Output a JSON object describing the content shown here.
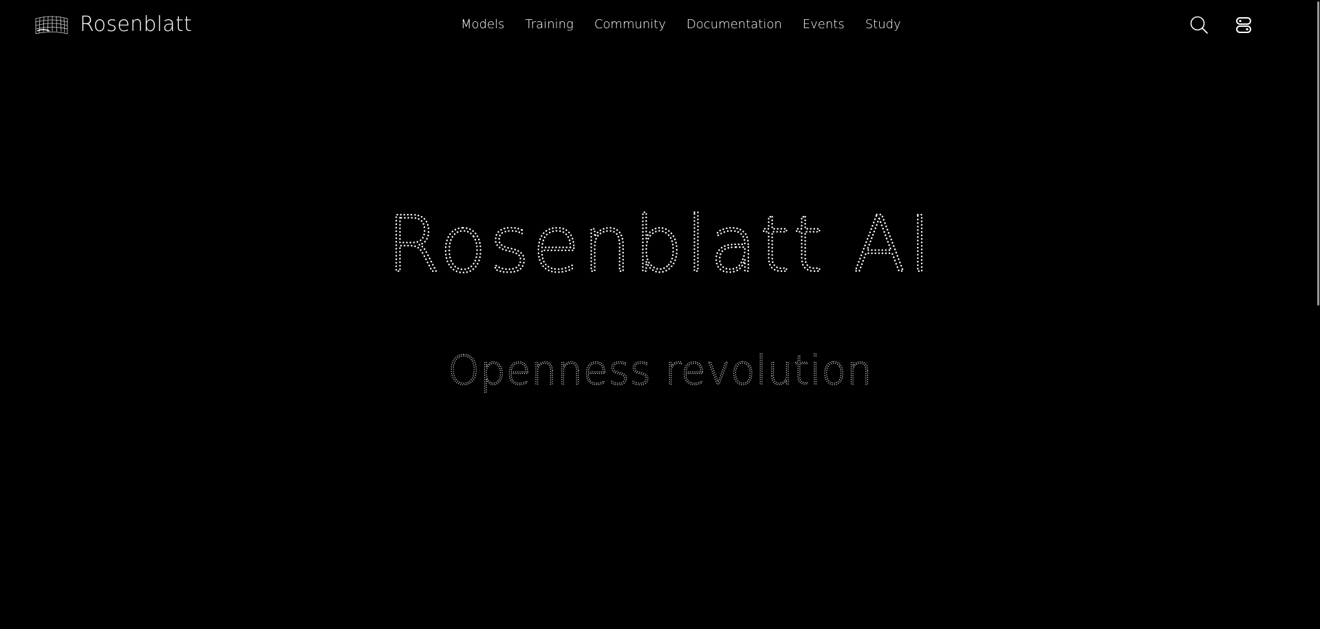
{
  "header": {
    "brand_name": "Rosenblatt",
    "logo_icon": "wireframe-mesh-logo"
  },
  "nav": {
    "items": [
      {
        "label": "Models"
      },
      {
        "label": "Training"
      },
      {
        "label": "Community"
      },
      {
        "label": "Documentation"
      },
      {
        "label": "Events"
      },
      {
        "label": "Study"
      }
    ]
  },
  "actions": {
    "search_icon": "search-icon",
    "menu_icon": "menu-toggle-icon"
  },
  "hero": {
    "title": "Rosenblatt AI",
    "subtitle": "Openness revolution"
  },
  "colors": {
    "background": "#000000",
    "text": "#ffffff",
    "subtitle_text": "#c8c8c8"
  }
}
